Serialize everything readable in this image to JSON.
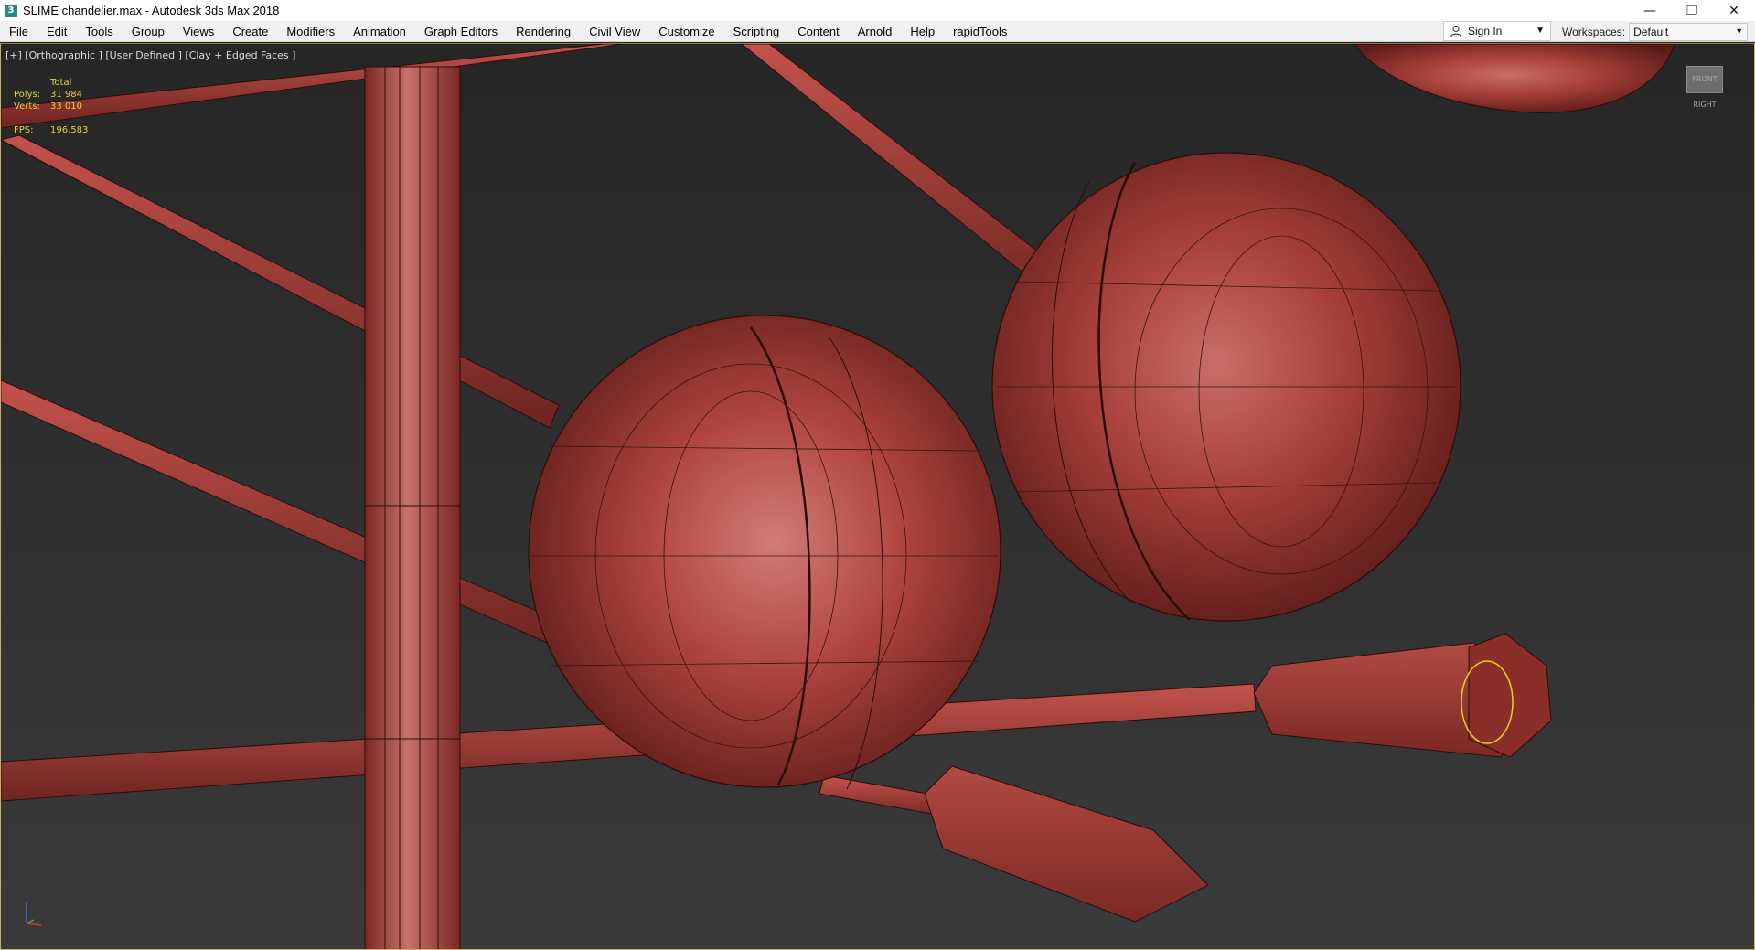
{
  "window": {
    "title": "SLIME chandelier.max - Autodesk 3ds Max 2018",
    "app_icon": "3",
    "controls": [
      "minimize-icon",
      "restore-icon",
      "close-icon"
    ],
    "control_glyphs": [
      "—",
      "❐",
      "✕"
    ]
  },
  "menu": {
    "items": [
      {
        "label": "File"
      },
      {
        "label": "Edit"
      },
      {
        "label": "Tools"
      },
      {
        "label": "Group"
      },
      {
        "label": "Views"
      },
      {
        "label": "Create"
      },
      {
        "label": "Modifiers"
      },
      {
        "label": "Animation"
      },
      {
        "label": "Graph Editors"
      },
      {
        "label": "Rendering"
      },
      {
        "label": "Civil View"
      },
      {
        "label": "Customize"
      },
      {
        "label": "Scripting"
      },
      {
        "label": "Content"
      },
      {
        "label": "Arnold"
      },
      {
        "label": "Help"
      },
      {
        "label": "rapidTools"
      }
    ],
    "sign_in": "Sign In",
    "workspaces_label": "Workspaces:",
    "workspace_value": "Default"
  },
  "viewport": {
    "label": "[+] [Orthographic ] [User Defined ] [Clay + Edged Faces ]",
    "stats": {
      "total_label": "Total",
      "polys_label": "Polys:",
      "polys_value": "31 984",
      "verts_label": "Verts:",
      "verts_value": "33 010",
      "fps_label": "FPS:",
      "fps_value": "196,583"
    },
    "viewcube_text": "FRONT RIGHT",
    "colors": {
      "clay": "#b0453f",
      "clay_dark": "#6e2320",
      "edge": "#2a0c0a",
      "stats_text": "#e6d23c",
      "highlight_border": "#c9b25e",
      "selection": "#e8d020"
    }
  }
}
